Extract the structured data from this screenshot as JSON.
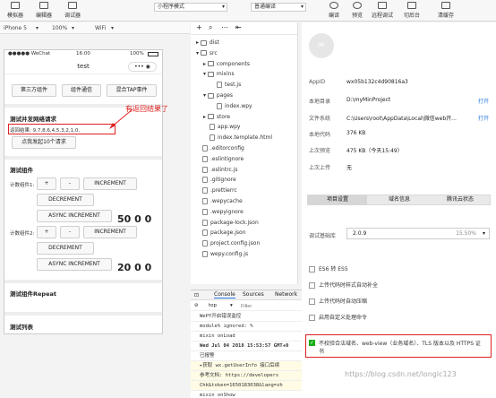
{
  "toolbar": {
    "simulator_label": "模拟器",
    "editor_label": "编辑器",
    "debugger_label": "调试器",
    "mode_select": "小程序模式",
    "compile_select": "普通编译",
    "compile_label": "编译",
    "preview_label": "预览",
    "remote_debug_label": "远程调试",
    "cut_backend_label": "切后台",
    "clear_cache_label": "清缓存"
  },
  "simbar": {
    "device": "iPhone 5",
    "zoom": "100%",
    "network": "WiFi"
  },
  "phone": {
    "carrier": "●●●●● WeChat",
    "time": "16:00",
    "battery": "100%",
    "nav_title": "test",
    "buttons": [
      "第三方组件",
      "组件通信",
      "混合TAP事件"
    ],
    "section1_title": "测试并发网络请求",
    "result_text": "返回结果: 9,7,8,6,4,5,3,2,1,0,",
    "annotation": "有返回结果了",
    "request_button": "点我发起10个请求",
    "section2_title": "测试组件",
    "counter1_label": "计数组件1:",
    "counter2_label": "计数组件2:",
    "plus": "+",
    "minus": "-",
    "increment": "INCREMENT",
    "decrement": "DECREMENT",
    "async_increment": "ASYNC INCREMENT",
    "value1": "50 0 0",
    "value2": "20 0 0",
    "section3_title": "测试组件Repeat",
    "section4_title": "测试列表"
  },
  "explorer": {
    "rows": [
      {
        "name": "dist",
        "type": "folder",
        "depth": 0,
        "expanded": false
      },
      {
        "name": "src",
        "type": "folder",
        "depth": 0,
        "expanded": true
      },
      {
        "name": "components",
        "type": "folder",
        "depth": 1,
        "expanded": false
      },
      {
        "name": "mixins",
        "type": "folder",
        "depth": 1,
        "expanded": true
      },
      {
        "name": "test.js",
        "type": "file",
        "depth": 2
      },
      {
        "name": "pages",
        "type": "folder",
        "depth": 1,
        "expanded": true
      },
      {
        "name": "index.wpy",
        "type": "file",
        "depth": 2
      },
      {
        "name": "store",
        "type": "folder",
        "depth": 1,
        "expanded": false
      },
      {
        "name": "app.wpy",
        "type": "file",
        "depth": 1
      },
      {
        "name": "index.template.html",
        "type": "file",
        "depth": 1
      },
      {
        "name": ".editorconfig",
        "type": "file",
        "depth": 0
      },
      {
        "name": ".eslintignore",
        "type": "file",
        "depth": 0
      },
      {
        "name": ".eslintrc.js",
        "type": "file",
        "depth": 0
      },
      {
        "name": ".gitignore",
        "type": "file",
        "depth": 0
      },
      {
        "name": ".prettierrc",
        "type": "file",
        "depth": 0
      },
      {
        "name": ".wepycache",
        "type": "file",
        "depth": 0
      },
      {
        "name": ".wepyignore",
        "type": "file",
        "depth": 0
      },
      {
        "name": "package-lock.json",
        "type": "file",
        "depth": 0
      },
      {
        "name": "package.json",
        "type": "file",
        "depth": 0
      },
      {
        "name": "project.config.json",
        "type": "file",
        "depth": 0
      },
      {
        "name": "wepy.config.js",
        "type": "file",
        "depth": 0
      }
    ]
  },
  "console": {
    "tabs": [
      "Console",
      "Sources",
      "Network"
    ],
    "filter_context": "top",
    "filter_placeholder": "Filter",
    "lines": [
      "WePY开启错误监控",
      "module% ignored: %",
      "mixin onLoad",
      "Wed Jul 04 2018 15:53:57 GMT+0",
      "已报警",
      "▸获取 wx.getUserInfo 接口后续",
      "  参考文档: https://developers",
      "  Chk&token=1650183038&lang=zh",
      "mixin onShow"
    ]
  },
  "details": {
    "appid_label": "AppID",
    "appid": "wx05b132c4d90816a3",
    "local_dir_label": "本地目录",
    "local_dir": "D:\\myMinProject",
    "file_sys_label": "文件系统",
    "file_sys": "C:\\Users\\root\\AppData\\Local\\微信web开...",
    "open_link": "打开",
    "local_code_label": "本地代码",
    "local_code": "376 KB",
    "last_preview_label": "上次预览",
    "last_preview": "475 KB（今天15:49）",
    "last_upload_label": "上次上传",
    "last_upload": "无",
    "tabs": [
      "项目设置",
      "域名信息",
      "腾讯云状态"
    ],
    "base_lib_label": "调试基础库",
    "base_lib_version": "2.0.9",
    "base_lib_percent": "15.50%",
    "checks": [
      {
        "label": "ES6 转 ES5",
        "checked": false
      },
      {
        "label": "上传代码时样式自动补全",
        "checked": false
      },
      {
        "label": "上传代码时自动压缩",
        "checked": false
      },
      {
        "label": "启用自定义处理命令",
        "checked": false
      },
      {
        "label": "不校验合法域名、web-view（业务域名）、TLS 版本以及 HTTPS 证书",
        "checked": true
      }
    ],
    "watermark": "https://blog.csdn.net/longlc123"
  },
  "colors": {
    "annotation_red": "#e02020",
    "checked_green": "#1aad19",
    "link_blue": "#2a7ae4"
  }
}
